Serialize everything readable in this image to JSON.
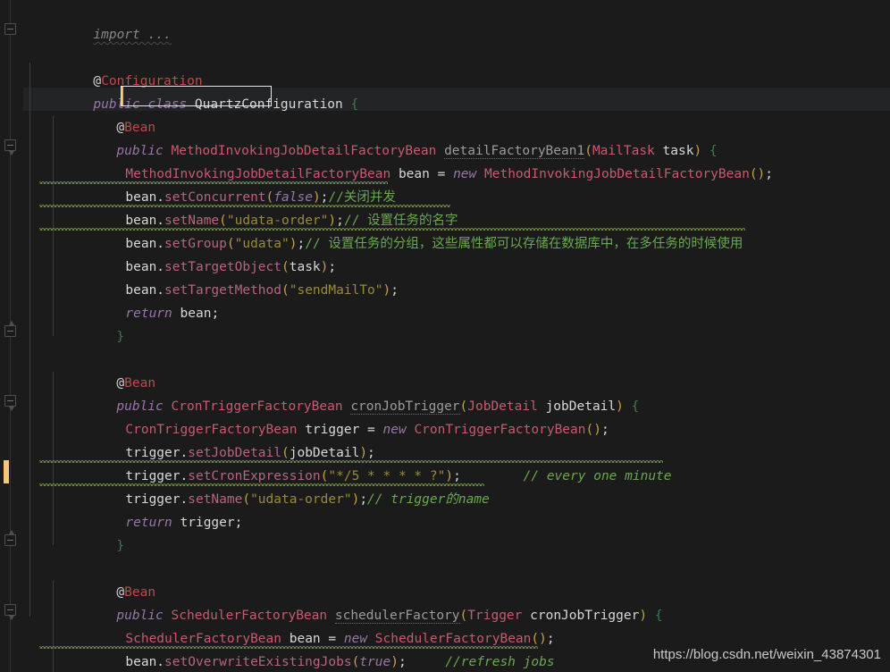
{
  "editor": {
    "background": "#1b1b1b",
    "current_line_background": "#232426",
    "font_size_px": 14.5,
    "line_height_px": 26
  },
  "colors": {
    "keyword": "#9876aa",
    "annotation": "#bf4a4a",
    "type": "#c9596e",
    "method_call": "#b5657f",
    "string": "#9a8a3c",
    "comment": "#6aa84f",
    "paren": "#c7a045",
    "plain_text": "#d8d8d8",
    "change_marker": "#f5c77e",
    "highlight_border": "#e8e8e8",
    "caret": "#ecb953"
  },
  "lines": {
    "l1_import": "import ...",
    "l3_annotation_at": "@",
    "l3_annotation_name": "Configuration",
    "l4_public": "public",
    "l4_class": "class",
    "l4_classname": "QuartzConfiguration",
    "l4_brace": "{",
    "l5_bean_at": "@",
    "l5_bean": "Bean",
    "l6_public": "public",
    "l6_type": "MethodInvokingJobDetailFactoryBean",
    "l6_name": "detailFactoryBean1",
    "l6_paramtype": "MailTask",
    "l6_paramname": "task",
    "l7_type": "MethodInvokingJobDetailFactoryBean",
    "l7_var": "bean",
    "l7_new": "new",
    "l7_ctor": "MethodInvokingJobDetailFactoryBean",
    "l8_obj": "bean.",
    "l8_method": "setConcurrent",
    "l8_arg": "false",
    "l8_comment": "//关闭并发",
    "l9_obj": "bean.",
    "l9_method": "setName",
    "l9_arg": "\"udata-order\"",
    "l9_comment": "// 设置任务的名字",
    "l10_obj": "bean.",
    "l10_method": "setGroup",
    "l10_arg": "\"udata\"",
    "l10_comment": "// 设置任务的分组，这些属性都可以存储在数据库中，在多任务的时候使用",
    "l11_obj": "bean.",
    "l11_method": "setTargetObject",
    "l11_arg": "task",
    "l12_obj": "bean.",
    "l12_method": "setTargetMethod",
    "l12_arg": "\"sendMailTo\"",
    "l13_return": "return",
    "l13_var": "bean",
    "l14_closebrace": "}",
    "l16_bean_at": "@",
    "l16_bean": "Bean",
    "l17_public": "public",
    "l17_type": "CronTriggerFactoryBean",
    "l17_name": "cronJobTrigger",
    "l17_paramtype": "JobDetail",
    "l17_paramname": "jobDetail",
    "l18_type": "CronTriggerFactoryBean",
    "l18_var": "trigger",
    "l18_new": "new",
    "l18_ctor": "CronTriggerFactoryBean",
    "l19_obj": "trigger.",
    "l19_method": "setJobDetail",
    "l19_arg": "jobDetail",
    "l20_obj": "trigger.",
    "l20_method": "setCronExpression",
    "l20_arg": "\"*/5 * * * * ?\"",
    "l20_comment": "// every one minute",
    "l21_obj": "trigger.",
    "l21_method": "setName",
    "l21_arg": "\"udata-order\"",
    "l21_comment": "// trigger的name",
    "l22_return": "return",
    "l22_var": "trigger",
    "l23_closebrace": "}",
    "l25_bean_at": "@",
    "l25_bean": "Bean",
    "l26_public": "public",
    "l26_type": "SchedulerFactoryBean",
    "l26_name": "schedulerFactory",
    "l26_paramtype": "Trigger",
    "l26_paramname": "cronJobTrigger",
    "l27_type": "SchedulerFactoryBean",
    "l27_var": "bean",
    "l27_new": "new",
    "l27_ctor": "SchedulerFactoryBean",
    "l28_obj": "bean.",
    "l28_method": "setOverwriteExistingJobs",
    "l28_arg": "true",
    "l28_comment": "//refresh jobs"
  },
  "punct": {
    "lparen": "(",
    "rparen": ")",
    "parens": "()",
    "semi": ";",
    "eq": "=",
    "brace_open": "{",
    "dot": "."
  },
  "watermark": {
    "text": "https://blog.csdn.net/weixin_43874301"
  }
}
